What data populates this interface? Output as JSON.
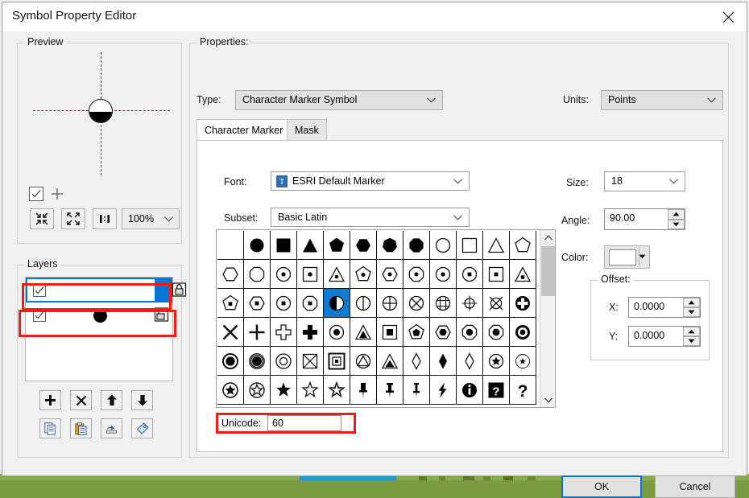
{
  "window": {
    "title": "Symbol Property Editor",
    "close_icon": "close-icon"
  },
  "preview": {
    "group_label": "Preview",
    "checkbox_checked": true,
    "plus_icon": "plus-icon",
    "buttons": [
      {
        "name": "zoom-out-button",
        "icon": "collapse-arrows-icon"
      },
      {
        "name": "zoom-in-button",
        "icon": "expand-arrows-icon"
      },
      {
        "name": "actual-size-button",
        "icon": "one-to-one-icon"
      }
    ],
    "zoom_value": "100%"
  },
  "layers": {
    "group_label": "Layers",
    "items": [
      {
        "name": "layer-row-1",
        "checked": true,
        "selected": true,
        "icon": "lock-icon",
        "symbol": "none"
      },
      {
        "name": "layer-row-2",
        "checked": true,
        "selected": false,
        "icon": "lock-open-icon",
        "symbol": "filled-circle"
      }
    ],
    "buttons_row1": [
      {
        "name": "add-layer-button",
        "icon": "plus-icon"
      },
      {
        "name": "delete-layer-button",
        "icon": "x-icon"
      },
      {
        "name": "move-layer-up-button",
        "icon": "arrow-up-icon"
      },
      {
        "name": "move-layer-down-button",
        "icon": "arrow-down-icon"
      }
    ],
    "buttons_row2": [
      {
        "name": "copy-layer-button",
        "icon": "copy-icon"
      },
      {
        "name": "paste-layer-button",
        "icon": "paste-icon"
      },
      {
        "name": "swap-layer-button",
        "icon": "swap-icon"
      },
      {
        "name": "tag-layer-button",
        "icon": "tag-icon"
      }
    ]
  },
  "properties": {
    "group_label": "Properties:",
    "type_label": "Type:",
    "type_value": "Character Marker Symbol",
    "units_label": "Units:",
    "units_value": "Points",
    "tabs": [
      {
        "label": "Character Marker",
        "active": true
      },
      {
        "label": "Mask",
        "active": false
      }
    ],
    "font_label": "Font:",
    "font_value": "ESRI Default Marker",
    "subset_label": "Subset:",
    "subset_value": "Basic Latin",
    "unicode_label": "Unicode:",
    "unicode_value": "60",
    "size_label": "Size:",
    "size_value": "18",
    "angle_label": "Angle:",
    "angle_value": "90.00",
    "color_label": "Color:",
    "color_value": "#ffffff",
    "offset_label": "Offset:",
    "offset_x_label": "X:",
    "offset_x_value": "0.0000",
    "offset_y_label": "Y:",
    "offset_y_value": "0.0000"
  },
  "char_grid": {
    "columns": 12,
    "rows": 6,
    "selected_index": 28,
    "scroll_position": "near-top",
    "cells": [
      "blank",
      "filled-circle",
      "filled-square",
      "filled-triangle",
      "filled-pentagon",
      "filled-hexagon",
      "filled-heptagon",
      "filled-octagon",
      "open-circle",
      "open-square",
      "open-triangle",
      "open-pentagon",
      "open-hexagon",
      "open-octagon",
      "circle-dot",
      "square-dot",
      "triangle-dot",
      "pentagon-dot",
      "hexagon-dot",
      "octagon-dot",
      "circle-dot2",
      "circle-square-dot",
      "square-square-dot",
      "triangle-square-dot",
      "pentagon-square-dot",
      "hexagon-square-dot",
      "circle-square-dot2",
      "octagon-square-dot",
      "half-filled-circle",
      "circle-vline",
      "circle-cross",
      "circle-x",
      "circle-grid",
      "circle-crosshair",
      "circle-x2",
      "filled-circle-plus",
      "x-mark",
      "plus-mark",
      "open-cross",
      "filled-cross",
      "circle-bullet",
      "triangle-bullet",
      "square-bullet",
      "pentagon-bullet",
      "hexagon-bullet",
      "octagon-bullet",
      "octagon-bullet2",
      "bullseye",
      "ring-filled",
      "target-rings",
      "ring-open",
      "square-x",
      "square-in-square",
      "circle-triangle",
      "triangle-filled-outline",
      "open-diamond",
      "filled-diamond",
      "open-diamond2",
      "circle-star",
      "circle-star-small",
      "circle-filled-star",
      "circle-open-star",
      "filled-star",
      "open-star",
      "star-outline",
      "pushpin-filled",
      "pushpin",
      "pushpin-thin",
      "lightning-bolt",
      "info-circle",
      "question-box",
      "question-mark"
    ]
  },
  "footer": {
    "ok_label": "OK",
    "cancel_label": "Cancel"
  }
}
